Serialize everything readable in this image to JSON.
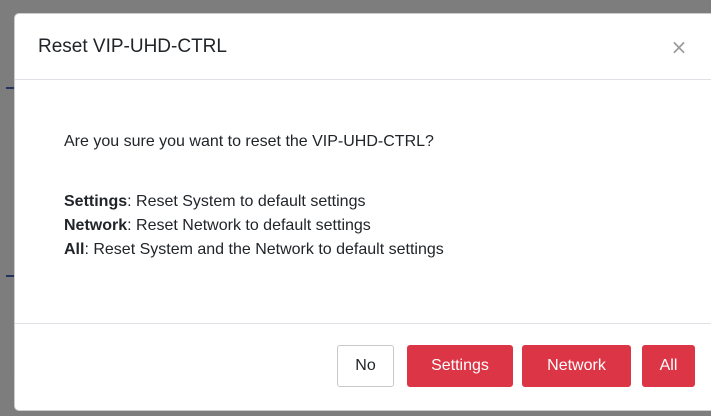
{
  "dialog": {
    "title": "Reset VIP-UHD-CTRL",
    "close_symbol": "×",
    "close_icon": "close-icon"
  },
  "body": {
    "prompt": "Are you sure you want to reset the VIP-UHD-CTRL?",
    "options": [
      {
        "name": "Settings",
        "description": ": Reset System to default settings"
      },
      {
        "name": "Network",
        "description": ": Reset Network to default settings"
      },
      {
        "name": "All",
        "description": ": Reset System and the Network to default settings"
      }
    ]
  },
  "footer": {
    "no_label": "No",
    "settings_label": "Settings",
    "network_label": "Network",
    "all_label": "All"
  },
  "colors": {
    "danger": "#dc3545",
    "backdrop": "#7d7d7d",
    "border": "#dee2e6"
  }
}
